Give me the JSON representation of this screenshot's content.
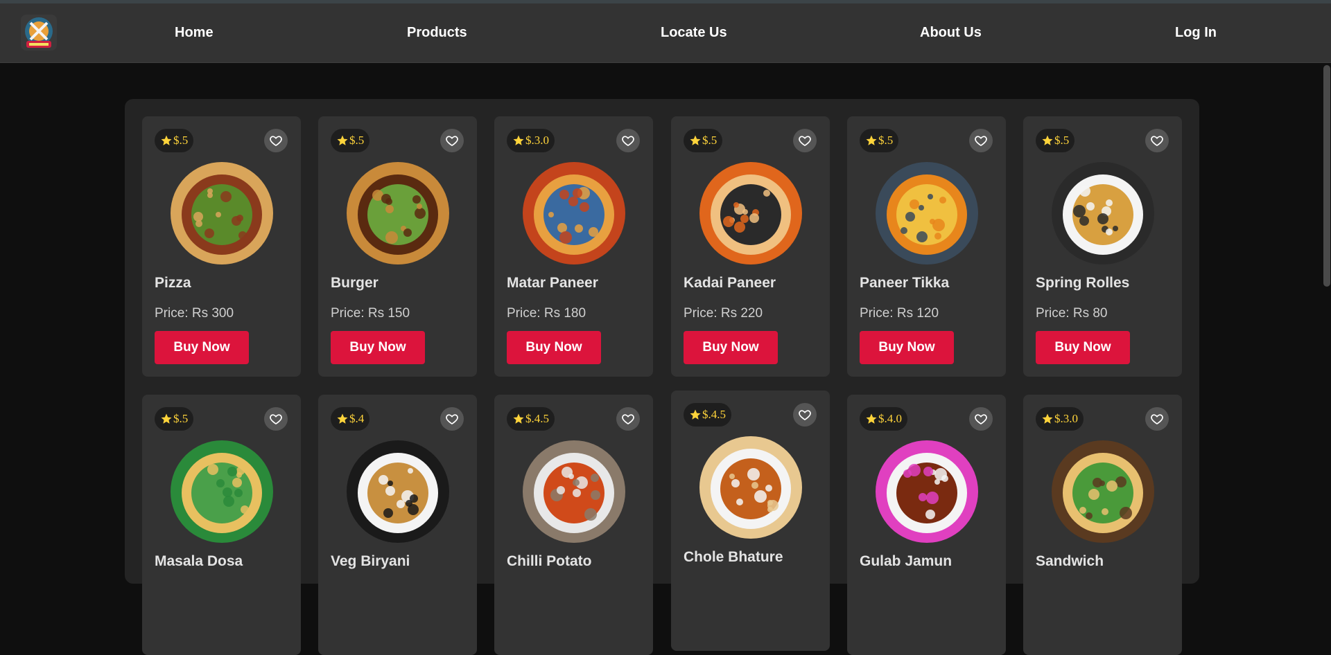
{
  "nav": {
    "items": [
      "Home",
      "Products",
      "Locate Us",
      "About Us",
      "Log In"
    ]
  },
  "colors": {
    "background": "#0f0f0f",
    "navbar": "#333333",
    "panel": "#242424",
    "card": "#333333",
    "button": "#dc143c",
    "rating_text": "#ffd43b"
  },
  "products": [
    {
      "rating": "$.5",
      "name": "Pizza",
      "price": "Price: Rs 300",
      "buy_label": "Buy Now",
      "image": "pizza",
      "colors": [
        "#d9a55a",
        "#8a3a1c",
        "#5a8a2a"
      ]
    },
    {
      "rating": "$.5",
      "name": "Burger",
      "price": "Price: Rs 150",
      "buy_label": "Buy Now",
      "image": "burger",
      "colors": [
        "#c98a3a",
        "#5a2a10",
        "#6aa03a"
      ]
    },
    {
      "rating": "$.3.0",
      "name": "Matar Paneer",
      "price": "Price: Rs 180",
      "buy_label": "Buy Now",
      "image": "matar-paneer",
      "colors": [
        "#c4441c",
        "#e8a040",
        "#3a6aa0"
      ]
    },
    {
      "rating": "$.5",
      "name": "Kadai Paneer",
      "price": "Price: Rs 220",
      "buy_label": "Buy Now",
      "image": "kadai-paneer",
      "colors": [
        "#e0661c",
        "#f0c080",
        "#2a2a2a"
      ]
    },
    {
      "rating": "$.5",
      "name": "Paneer Tikka",
      "price": "Price: Rs 120",
      "buy_label": "Buy Now",
      "image": "paneer-tikka",
      "colors": [
        "#3a4a5a",
        "#e8861c",
        "#f0c040"
      ]
    },
    {
      "rating": "$.5",
      "name": "Spring Rolles",
      "price": "Price: Rs 80",
      "buy_label": "Buy Now",
      "image": "spring-rolls",
      "colors": [
        "#2a2a2a",
        "#f4f4f4",
        "#d8a040"
      ]
    },
    {
      "rating": "$.5",
      "name": "Masala Dosa",
      "price": "",
      "buy_label": "",
      "image": "masala-dosa",
      "colors": [
        "#2a8a3a",
        "#e8c060",
        "#4aa04a"
      ]
    },
    {
      "rating": "$.4",
      "name": "Veg Biryani",
      "price": "",
      "buy_label": "",
      "image": "veg-biryani",
      "colors": [
        "#1a1a1a",
        "#f4f4f4",
        "#c89040"
      ]
    },
    {
      "rating": "$.4.5",
      "name": "Chilli Potato",
      "price": "",
      "buy_label": "",
      "image": "chilli-potato",
      "colors": [
        "#8a7a6a",
        "#e8e8e8",
        "#d04a1a"
      ]
    },
    {
      "rating": "$.4.5",
      "name": "Chole Bhature",
      "price": "",
      "buy_label": "",
      "image": "chole-bhature",
      "colors": [
        "#e8c890",
        "#f4f4f4",
        "#c4601c"
      ]
    },
    {
      "rating": "$.4.0",
      "name": "Gulab Jamun",
      "price": "",
      "buy_label": "",
      "image": "gulab-jamun",
      "colors": [
        "#e040c0",
        "#f4f4f4",
        "#7a2a10"
      ]
    },
    {
      "rating": "$.3.0",
      "name": "Sandwich",
      "price": "",
      "buy_label": "",
      "image": "sandwich",
      "colors": [
        "#5a3a20",
        "#e8c070",
        "#4a9a3a"
      ]
    }
  ]
}
